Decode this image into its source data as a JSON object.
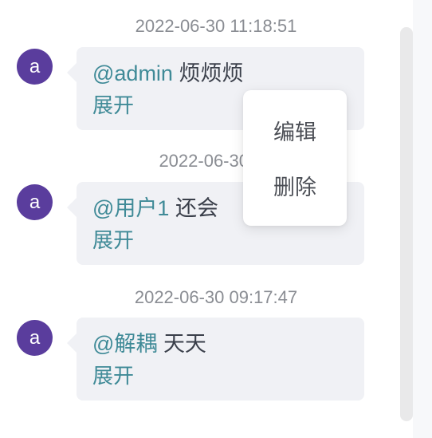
{
  "messages": [
    {
      "timestamp": "2022-06-30 11:18:51",
      "avatar_letter": "a",
      "mention": "@admin",
      "text": "烦烦烦",
      "expand_label": "展开"
    },
    {
      "timestamp": "2022-06-30 10",
      "avatar_letter": "a",
      "mention": "@用户1",
      "text": "还会",
      "expand_label": "展开"
    },
    {
      "timestamp": "2022-06-30 09:17:47",
      "avatar_letter": "a",
      "mention": "@解耦",
      "text": "天天",
      "expand_label": "展开"
    }
  ],
  "context_menu": {
    "items": [
      {
        "label": "编辑"
      },
      {
        "label": "删除"
      }
    ]
  },
  "colors": {
    "accent": "#3f8a97",
    "avatar_bg": "#5a3d9d",
    "bubble_bg": "#f0f1f5",
    "timestamp": "#8a8d93"
  }
}
